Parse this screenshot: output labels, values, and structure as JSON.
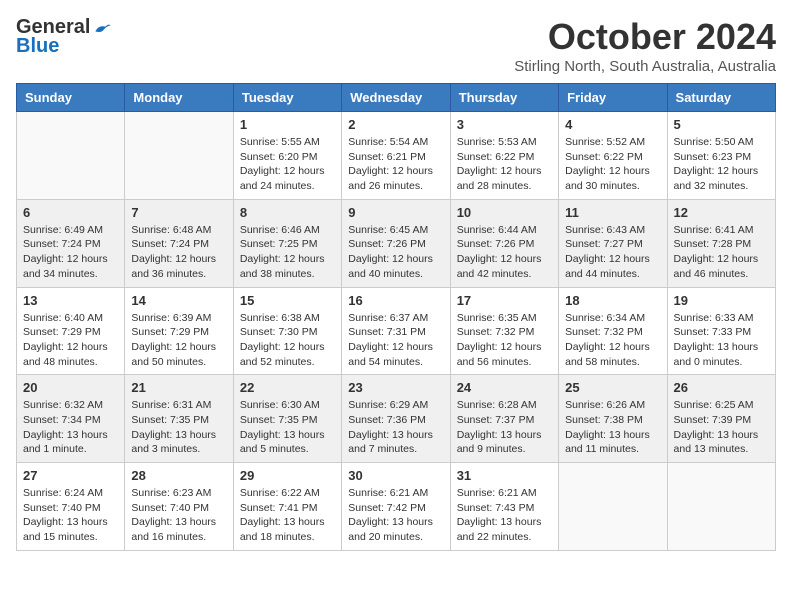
{
  "logo": {
    "general": "General",
    "blue": "Blue"
  },
  "title": "October 2024",
  "subtitle": "Stirling North, South Australia, Australia",
  "days_of_week": [
    "Sunday",
    "Monday",
    "Tuesday",
    "Wednesday",
    "Thursday",
    "Friday",
    "Saturday"
  ],
  "weeks": [
    [
      {
        "day": "",
        "info": ""
      },
      {
        "day": "",
        "info": ""
      },
      {
        "day": "1",
        "info": "Sunrise: 5:55 AM\nSunset: 6:20 PM\nDaylight: 12 hours\nand 24 minutes."
      },
      {
        "day": "2",
        "info": "Sunrise: 5:54 AM\nSunset: 6:21 PM\nDaylight: 12 hours\nand 26 minutes."
      },
      {
        "day": "3",
        "info": "Sunrise: 5:53 AM\nSunset: 6:22 PM\nDaylight: 12 hours\nand 28 minutes."
      },
      {
        "day": "4",
        "info": "Sunrise: 5:52 AM\nSunset: 6:22 PM\nDaylight: 12 hours\nand 30 minutes."
      },
      {
        "day": "5",
        "info": "Sunrise: 5:50 AM\nSunset: 6:23 PM\nDaylight: 12 hours\nand 32 minutes."
      }
    ],
    [
      {
        "day": "6",
        "info": "Sunrise: 6:49 AM\nSunset: 7:24 PM\nDaylight: 12 hours\nand 34 minutes."
      },
      {
        "day": "7",
        "info": "Sunrise: 6:48 AM\nSunset: 7:24 PM\nDaylight: 12 hours\nand 36 minutes."
      },
      {
        "day": "8",
        "info": "Sunrise: 6:46 AM\nSunset: 7:25 PM\nDaylight: 12 hours\nand 38 minutes."
      },
      {
        "day": "9",
        "info": "Sunrise: 6:45 AM\nSunset: 7:26 PM\nDaylight: 12 hours\nand 40 minutes."
      },
      {
        "day": "10",
        "info": "Sunrise: 6:44 AM\nSunset: 7:26 PM\nDaylight: 12 hours\nand 42 minutes."
      },
      {
        "day": "11",
        "info": "Sunrise: 6:43 AM\nSunset: 7:27 PM\nDaylight: 12 hours\nand 44 minutes."
      },
      {
        "day": "12",
        "info": "Sunrise: 6:41 AM\nSunset: 7:28 PM\nDaylight: 12 hours\nand 46 minutes."
      }
    ],
    [
      {
        "day": "13",
        "info": "Sunrise: 6:40 AM\nSunset: 7:29 PM\nDaylight: 12 hours\nand 48 minutes."
      },
      {
        "day": "14",
        "info": "Sunrise: 6:39 AM\nSunset: 7:29 PM\nDaylight: 12 hours\nand 50 minutes."
      },
      {
        "day": "15",
        "info": "Sunrise: 6:38 AM\nSunset: 7:30 PM\nDaylight: 12 hours\nand 52 minutes."
      },
      {
        "day": "16",
        "info": "Sunrise: 6:37 AM\nSunset: 7:31 PM\nDaylight: 12 hours\nand 54 minutes."
      },
      {
        "day": "17",
        "info": "Sunrise: 6:35 AM\nSunset: 7:32 PM\nDaylight: 12 hours\nand 56 minutes."
      },
      {
        "day": "18",
        "info": "Sunrise: 6:34 AM\nSunset: 7:32 PM\nDaylight: 12 hours\nand 58 minutes."
      },
      {
        "day": "19",
        "info": "Sunrise: 6:33 AM\nSunset: 7:33 PM\nDaylight: 13 hours\nand 0 minutes."
      }
    ],
    [
      {
        "day": "20",
        "info": "Sunrise: 6:32 AM\nSunset: 7:34 PM\nDaylight: 13 hours\nand 1 minute."
      },
      {
        "day": "21",
        "info": "Sunrise: 6:31 AM\nSunset: 7:35 PM\nDaylight: 13 hours\nand 3 minutes."
      },
      {
        "day": "22",
        "info": "Sunrise: 6:30 AM\nSunset: 7:35 PM\nDaylight: 13 hours\nand 5 minutes."
      },
      {
        "day": "23",
        "info": "Sunrise: 6:29 AM\nSunset: 7:36 PM\nDaylight: 13 hours\nand 7 minutes."
      },
      {
        "day": "24",
        "info": "Sunrise: 6:28 AM\nSunset: 7:37 PM\nDaylight: 13 hours\nand 9 minutes."
      },
      {
        "day": "25",
        "info": "Sunrise: 6:26 AM\nSunset: 7:38 PM\nDaylight: 13 hours\nand 11 minutes."
      },
      {
        "day": "26",
        "info": "Sunrise: 6:25 AM\nSunset: 7:39 PM\nDaylight: 13 hours\nand 13 minutes."
      }
    ],
    [
      {
        "day": "27",
        "info": "Sunrise: 6:24 AM\nSunset: 7:40 PM\nDaylight: 13 hours\nand 15 minutes."
      },
      {
        "day": "28",
        "info": "Sunrise: 6:23 AM\nSunset: 7:40 PM\nDaylight: 13 hours\nand 16 minutes."
      },
      {
        "day": "29",
        "info": "Sunrise: 6:22 AM\nSunset: 7:41 PM\nDaylight: 13 hours\nand 18 minutes."
      },
      {
        "day": "30",
        "info": "Sunrise: 6:21 AM\nSunset: 7:42 PM\nDaylight: 13 hours\nand 20 minutes."
      },
      {
        "day": "31",
        "info": "Sunrise: 6:21 AM\nSunset: 7:43 PM\nDaylight: 13 hours\nand 22 minutes."
      },
      {
        "day": "",
        "info": ""
      },
      {
        "day": "",
        "info": ""
      }
    ]
  ]
}
